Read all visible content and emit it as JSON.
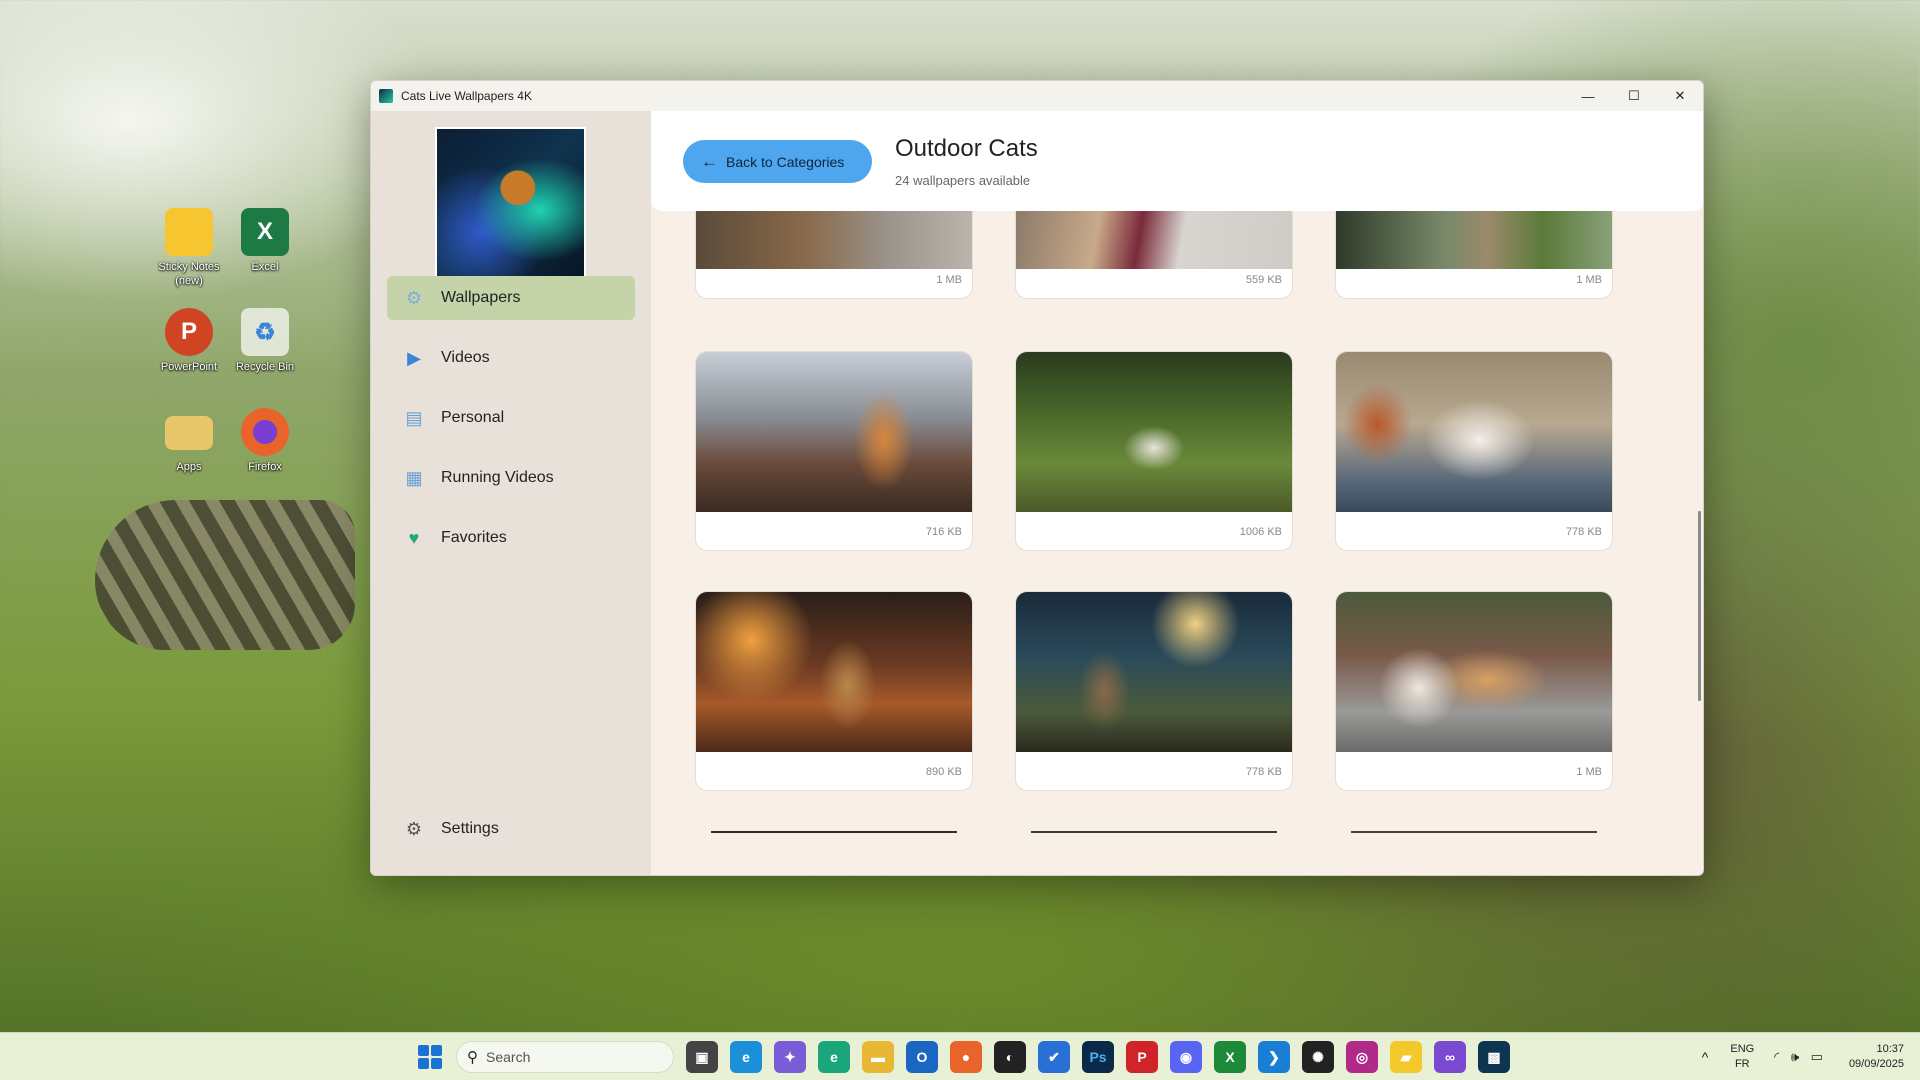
{
  "desktop": {
    "icons": [
      {
        "label": "Sticky Notes (new)",
        "glyph": "",
        "color": "#f6c52f"
      },
      {
        "label": "Excel",
        "glyph": "X",
        "color": "#1d7a45"
      },
      {
        "label": "PowerPoint",
        "glyph": "P",
        "color": "#d04423"
      },
      {
        "label": "Recycle Bin",
        "glyph": "♻",
        "color": "#5aa0d6"
      },
      {
        "label": "Apps",
        "glyph": "",
        "color": "#e8c66a"
      },
      {
        "label": "Firefox",
        "glyph": "",
        "color": "#e8642b"
      }
    ]
  },
  "window": {
    "title": "Cats Live Wallpapers 4K",
    "controls": {
      "minimize": "—",
      "maximize": "☐",
      "close": "✕"
    }
  },
  "sidebar": {
    "items": [
      {
        "label": "Wallpapers",
        "icon": "gear-icon",
        "glyph": "⚙",
        "color": "#7cb0d6"
      },
      {
        "label": "Videos",
        "icon": "play-icon",
        "glyph": "▶",
        "color": "#3a86d6"
      },
      {
        "label": "Personal",
        "icon": "folder-icon",
        "glyph": "▤",
        "color": "#6a9fd4"
      },
      {
        "label": "Running Videos",
        "icon": "grid-icon",
        "glyph": "▦",
        "color": "#6a9fd4"
      },
      {
        "label": "Favorites",
        "icon": "heart-icon",
        "glyph": "♥",
        "color": "#22a87a"
      }
    ],
    "settings": {
      "label": "Settings",
      "glyph": "⚙"
    }
  },
  "header": {
    "back_label": "Back to Categories",
    "back_arrow": "←",
    "title": "Outdoor Cats",
    "subtitle": "24 wallpapers available"
  },
  "wallpapers": [
    {
      "size": "1 MB"
    },
    {
      "size": "559 KB"
    },
    {
      "size": "1 MB"
    },
    {
      "size": "716 KB"
    },
    {
      "size": "1006 KB"
    },
    {
      "size": "778 KB"
    },
    {
      "size": "890 KB"
    },
    {
      "size": "778 KB"
    },
    {
      "size": "1 MB"
    }
  ],
  "taskbar": {
    "search_placeholder": "Search",
    "apps": [
      {
        "name": "task-view-icon",
        "glyph": "▣",
        "color": "#444"
      },
      {
        "name": "edge-icon",
        "glyph": "e",
        "color": "#1b8fd8"
      },
      {
        "name": "copilot-icon",
        "glyph": "✦",
        "color": "#7a5cd6"
      },
      {
        "name": "edge-dev-icon",
        "glyph": "e",
        "color": "#1aa67a"
      },
      {
        "name": "file-explorer-icon",
        "glyph": "▬",
        "color": "#e8b835"
      },
      {
        "name": "outlook-icon",
        "glyph": "O",
        "color": "#1a66c2"
      },
      {
        "name": "firefox-icon",
        "glyph": "●",
        "color": "#e8642b"
      },
      {
        "name": "app-icon",
        "glyph": "◐",
        "color": "#222"
      },
      {
        "name": "todo-icon",
        "glyph": "✔",
        "color": "#2a6fd6"
      },
      {
        "name": "photoshop-icon",
        "glyph": "Ps",
        "color": "#0b2a4a"
      },
      {
        "name": "pinterest-icon",
        "glyph": "P",
        "color": "#d0232a"
      },
      {
        "name": "discord-icon",
        "glyph": "◉",
        "color": "#5865f2"
      },
      {
        "name": "xbox-icon",
        "glyph": "X",
        "color": "#1d8a3a"
      },
      {
        "name": "vscode-icon",
        "glyph": "❯",
        "color": "#1a7fd4"
      },
      {
        "name": "chatgpt-icon",
        "glyph": "✺",
        "color": "#222"
      },
      {
        "name": "app2-icon",
        "glyph": "◎",
        "color": "#b02a8a"
      },
      {
        "name": "sticky-notes-icon",
        "glyph": "▰",
        "color": "#f3c82a"
      },
      {
        "name": "visual-studio-icon",
        "glyph": "∞",
        "color": "#7a4bd0"
      },
      {
        "name": "cats-wallpaper-icon",
        "glyph": "▩",
        "color": "#0d3550"
      }
    ],
    "tray_chevron": "^",
    "lang_line1": "ENG",
    "lang_line2": "FR",
    "sys_icons": "◜ 🕪 ▭",
    "time": "10:37",
    "date": "09/09/2025"
  }
}
